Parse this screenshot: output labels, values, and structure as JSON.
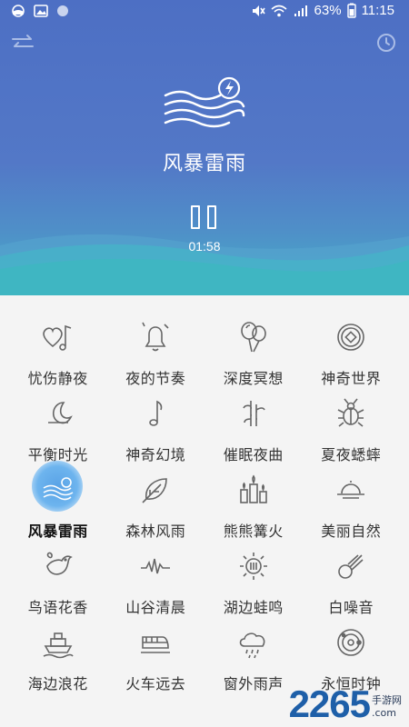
{
  "statusbar": {
    "battery": "63%",
    "time": "11:15"
  },
  "header": {
    "left_icon": "shuffle-icon",
    "right_icon": "clock-icon",
    "hero_icon": "storm-wind-icon",
    "title": "风暴雷雨",
    "state_icon": "pause-icon",
    "timer": "01:58"
  },
  "sounds": [
    {
      "label": "忧伤静夜",
      "icon": "heart-music-icon"
    },
    {
      "label": "夜的节奏",
      "icon": "bell-icon"
    },
    {
      "label": "深度冥想",
      "icon": "balloons-icon"
    },
    {
      "label": "神奇世界",
      "icon": "coin-icon"
    },
    {
      "label": "平衡时光",
      "icon": "moon-icon"
    },
    {
      "label": "神奇幻境",
      "icon": "music-note-icon"
    },
    {
      "label": "催眠夜曲",
      "icon": "bamboo-icon"
    },
    {
      "label": "夏夜蟋蟀",
      "icon": "cricket-icon"
    },
    {
      "label": "风暴雷雨",
      "icon": "storm-icon",
      "active": true
    },
    {
      "label": "森林风雨",
      "icon": "leaf-icon"
    },
    {
      "label": "熊熊篝火",
      "icon": "candles-icon"
    },
    {
      "label": "美丽自然",
      "icon": "sunset-icon"
    },
    {
      "label": "鸟语花香",
      "icon": "bird-icon"
    },
    {
      "label": "山谷清晨",
      "icon": "waveform-icon"
    },
    {
      "label": "湖边蛙鸣",
      "icon": "sun-icon"
    },
    {
      "label": "白噪音",
      "icon": "comet-icon"
    },
    {
      "label": "海边浪花",
      "icon": "ship-icon"
    },
    {
      "label": "火车远去",
      "icon": "train-icon"
    },
    {
      "label": "窗外雨声",
      "icon": "rain-cloud-icon"
    },
    {
      "label": "永恒时钟",
      "icon": "orbit-icon"
    }
  ],
  "watermark": {
    "number": "2265",
    "suffix": ".com",
    "sub": "手游网"
  },
  "colors": {
    "header_top": "#4d6fc4",
    "header_wave": "#45b0c9",
    "active_icon_bg": "#5aa3e6",
    "label_text": "#333333"
  }
}
